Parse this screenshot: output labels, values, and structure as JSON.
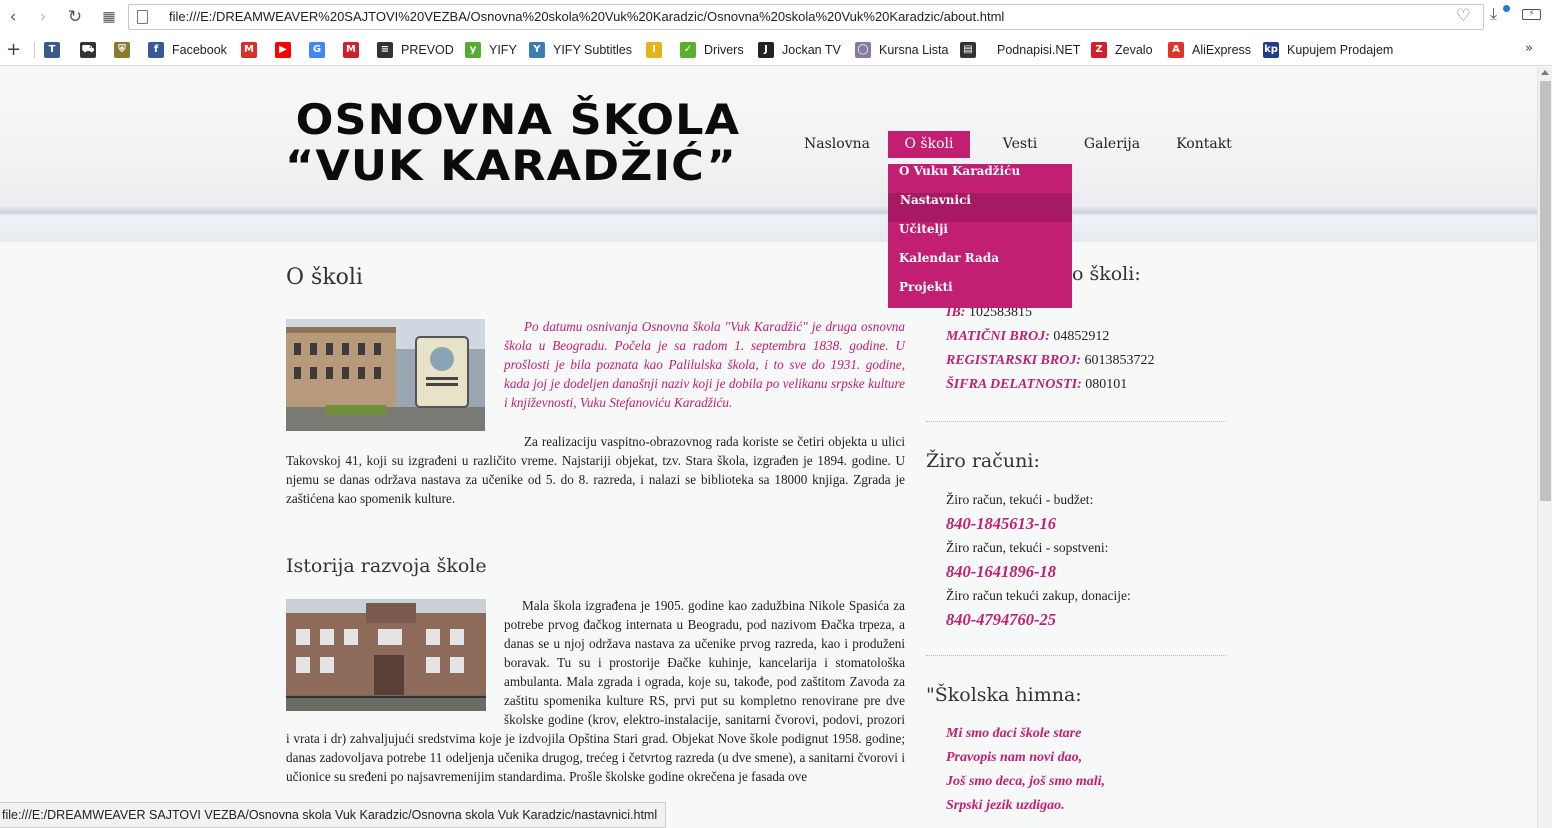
{
  "browser": {
    "url": "file:///E:/DREAMWEAVER%20SAJTOVI%20VEZBA/Osnovna%20skola%20Vuk%20Karadzic/Osnovna%20skola%20Vuk%20Karadzic/about.html",
    "status_url": "file:///E:/DREAMWEAVER SAJTOVI VEZBA/Osnovna skola Vuk Karadzic/Osnovna skola Vuk Karadzic/nastavnici.html",
    "bookmarks": [
      {
        "label": "",
        "icon": "t2-icon",
        "color": "#3a5a8c"
      },
      {
        "label": "",
        "icon": "car-icon",
        "color": "#333333"
      },
      {
        "label": "",
        "icon": "shield-icon",
        "color": "#8a7a2a"
      },
      {
        "label": "Facebook",
        "icon": "facebook-icon",
        "color": "#3b5998"
      },
      {
        "label": "",
        "icon": "gmail-icon",
        "color": "#d93025"
      },
      {
        "label": "",
        "icon": "youtube-icon",
        "color": "#ff0000"
      },
      {
        "label": "",
        "icon": "translate-icon",
        "color": "#4285f4"
      },
      {
        "label": "",
        "icon": "m-icon",
        "color": "#d0202a"
      },
      {
        "label": "PREVOD",
        "icon": "prevod-icon",
        "color": "#333333"
      },
      {
        "label": "YIFY",
        "icon": "yify-icon",
        "color": "#55aa33"
      },
      {
        "label": "YIFY Subtitles",
        "icon": "yify-subtitles-icon",
        "color": "#3a7fb0"
      },
      {
        "label": "",
        "icon": "imdb-icon",
        "color": "#e2b616"
      },
      {
        "label": "Drivers",
        "icon": "drivers-icon",
        "color": "#5ab02c"
      },
      {
        "label": "Jockan TV",
        "icon": "jockan-tv-icon",
        "color": "#222222"
      },
      {
        "label": "Kursna Lista",
        "icon": "kursna-lista-icon",
        "color": "#8a7aa0"
      },
      {
        "label": "",
        "icon": "document-icon",
        "color": "#333333"
      },
      {
        "label": "Podnapisi.NET",
        "icon": "podnapisi-icon",
        "color": "#ffffff"
      },
      {
        "label": "Zevalo",
        "icon": "zevalo-icon",
        "color": "#d0202a"
      },
      {
        "label": "AliExpress",
        "icon": "aliexpress-icon",
        "color": "#e0352b"
      },
      {
        "label": "Kupujem Prodajem",
        "icon": "kupujem-prodajem-icon",
        "color": "#1f3f8a"
      }
    ]
  },
  "site": {
    "logo_line1": "OSNOVNA ŠKOLA",
    "logo_line2": "“VUK KARADŽIĆ”",
    "menu": [
      {
        "label": "Naslovna",
        "active": false
      },
      {
        "label": "O školi",
        "active": true
      },
      {
        "label": "Vesti",
        "active": false
      },
      {
        "label": "Galerija",
        "active": false
      },
      {
        "label": "Kontakt",
        "active": false
      }
    ],
    "dropdown": [
      {
        "label": "O Vuku Karadžiću",
        "hover": false
      },
      {
        "label": "Nastavnici",
        "hover": true
      },
      {
        "label": "Učitelji",
        "hover": false
      },
      {
        "label": "Kalendar Rada",
        "hover": false
      },
      {
        "label": "Projekti",
        "hover": false
      }
    ]
  },
  "main": {
    "heading1": "O školi",
    "intro": "Po datumu osnivanja Osnovna škola \"Vuk Karadžić\" je druga osnovna škola u Beogradu. Počela je sa radom 1. septembra 1838. godine. U prošlosti je bila poznata kao Palilulska škola, i to sve do 1931. godine, kada joj je dodeljen današnji naziv koji je dobila po velikanu srpske kulture i književnosti, Vuku Stefanoviću Karadžiću.",
    "para1": "Za realizaciju vaspitno-obrazovnog rada koriste se četiri objekta u ulici Takovskoj 41, koji su izgrađeni u različito vreme. Najstariji objekat, tzv. Stara škola, izgrađen je 1894. godine. U njemu se danas održava nastava za učenike od 5. do 8. razreda, i nalazi se biblioteka sa 18000 knjiga. Zgrada je zaštićena kao spomenik kulture.",
    "heading2": "Istorija razvoja škole",
    "para2": "Mala škola izgrađena je 1905. godine kao zadužbina Nikole Spasića za potrebe prvog đačkog internata u Beogradu, pod nazivom Đačka trpeza, a danas se u njoj održava nastava za učenike prvog razreda, kao i produženi boravak. Tu su i prostorije Đačke kuhinje, kancelarija i stomatološka ambulanta. Mala zgrada i ograda, koje su, takođe, pod zaštitom Zavoda za zaštitu spomenika kulture RS, prvi put su kompletno renovirane pre dve školske godine (krov, elektro-instalacije, sanitarni čvorovi, podovi, prozori i vrata i dr) zahvaljujući sredstvima koje je izdvojila Opština Stari grad. Objekat Nove škole podignut 1958. godine; danas zadovoljava potrebe 11 odeljenja učenika drugog, trećeg i četvrtog razreda (u dve smene), a sanitarni čvorovi i učionice su sređeni po najsavremenijim standardima. Prošle školske godine okrečena je fasada ove"
  },
  "sidebar": {
    "info_heading_tail": "o školi:",
    "info": [
      {
        "key": "IB:",
        "value": "102583815"
      },
      {
        "key": "MATIČNI BROJ:",
        "value": "04852912"
      },
      {
        "key": "REGISTARSKI BROJ:",
        "value": "6013853722"
      },
      {
        "key": "ŠIFRA DELATNOSTI:",
        "value": "080101"
      }
    ],
    "accounts_heading": "Žiro računi:",
    "accounts": [
      {
        "label": "Žiro račun, tekući - budžet:",
        "number": "840-1845613-16"
      },
      {
        "label": "Žiro račun, tekući - sopstveni:",
        "number": "840-1641896-18"
      },
      {
        "label": "Žiro račun tekući zakup, donacije:",
        "number": "840-4794760-25"
      }
    ],
    "anthem_heading": "\"Školska himna:",
    "anthem": [
      "Mi smo đaci škole stare",
      "Pravopis nam novi dao,",
      "Još smo deca, još smo mali,",
      "Srpski jezik uzdigao."
    ]
  }
}
